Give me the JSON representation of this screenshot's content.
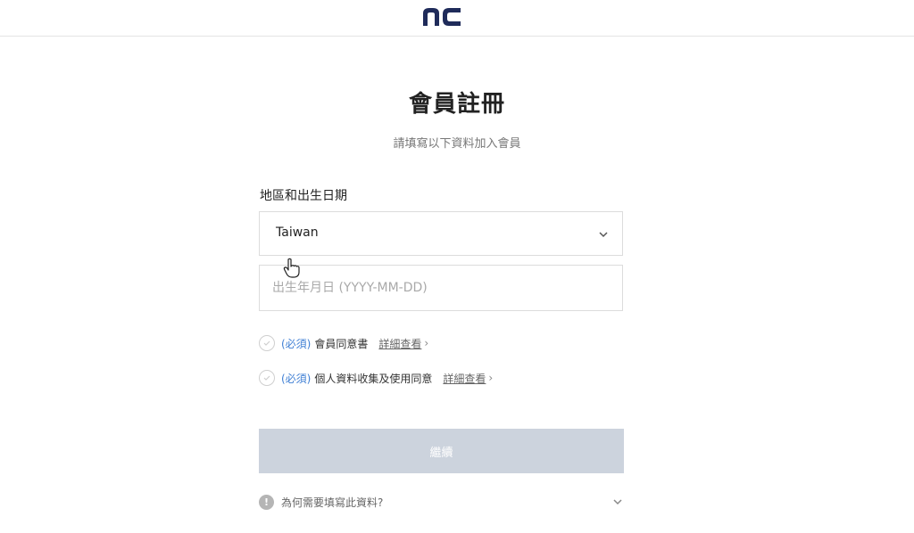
{
  "header": {
    "logo_text": "nc",
    "brand_color": "#1f2b5a"
  },
  "page": {
    "title": "會員註冊",
    "subtitle": "請填寫以下資料加入會員"
  },
  "form": {
    "section_label": "地區和出生日期",
    "region": {
      "selected_value": "Taiwan"
    },
    "birthdate": {
      "value": "",
      "placeholder": "出生年月日 (YYYY-MM-DD)"
    },
    "agreements": [
      {
        "required_label": "(必須)",
        "text": "會員同意書",
        "detail_label": "詳細查看",
        "checked": false
      },
      {
        "required_label": "(必須)",
        "text": "個人資料收集及使用同意",
        "detail_label": "詳細查看",
        "checked": false
      }
    ],
    "submit_label": "繼續",
    "submit_color": "#ccd3dd",
    "required_color": "#3f7fd4"
  },
  "faq": {
    "info_icon": "info-icon",
    "text": "為何需要填寫此資料?"
  }
}
